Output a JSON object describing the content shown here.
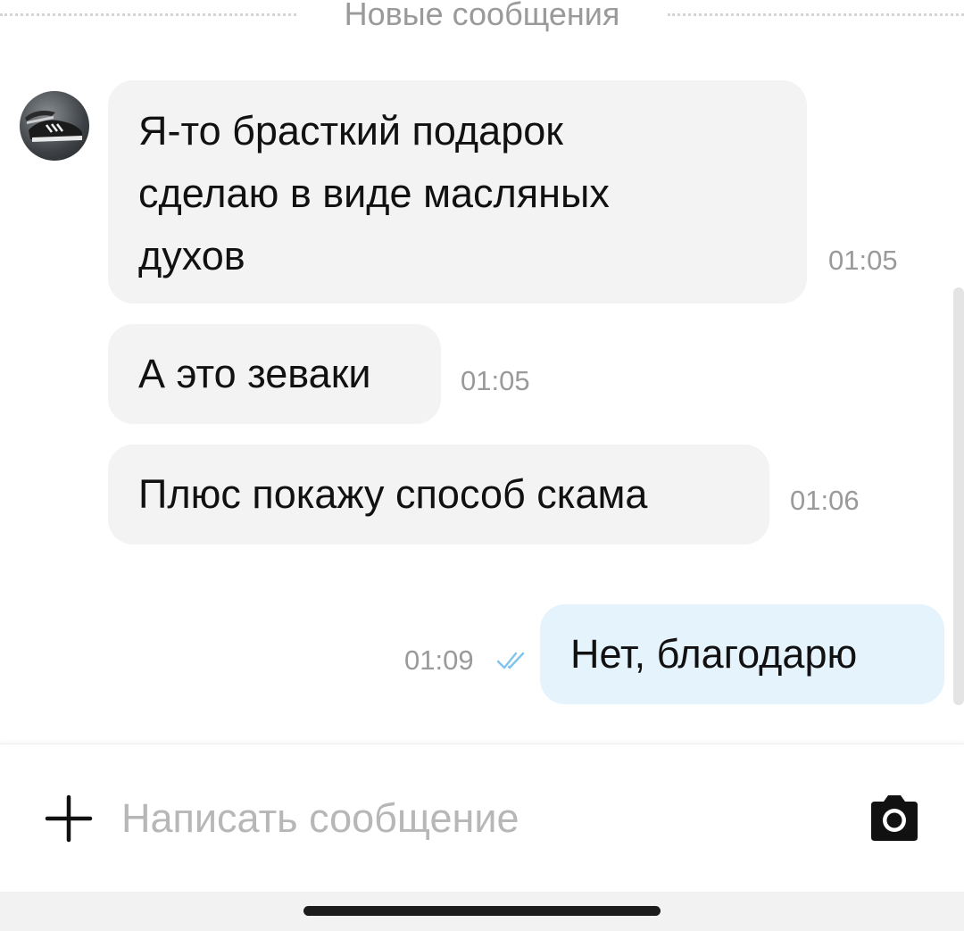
{
  "divider": {
    "label": "Новые сообщения"
  },
  "messages": [
    {
      "direction": "incoming",
      "lines": [
        "Я-то бpасткий подарок",
        "сделаю в виде масляных",
        "духов"
      ],
      "time": "01:05"
    },
    {
      "direction": "incoming",
      "lines": [
        "А это зеваки"
      ],
      "time": "01:05"
    },
    {
      "direction": "incoming",
      "lines": [
        "Плюс покажу способ скама"
      ],
      "time": "01:06"
    },
    {
      "direction": "outgoing",
      "lines": [
        "Нет, благодарю"
      ],
      "time": "01:09",
      "status": "read"
    }
  ],
  "composer": {
    "placeholder": "Написать сообщение",
    "value": "",
    "attach_icon": "plus-icon",
    "camera_icon": "camera-icon"
  },
  "colors": {
    "incoming_bubble": "#f3f3f3",
    "outgoing_bubble": "#e5f3fd",
    "read_check": "#7fc4ee",
    "meta_text": "#9a9a9a"
  }
}
